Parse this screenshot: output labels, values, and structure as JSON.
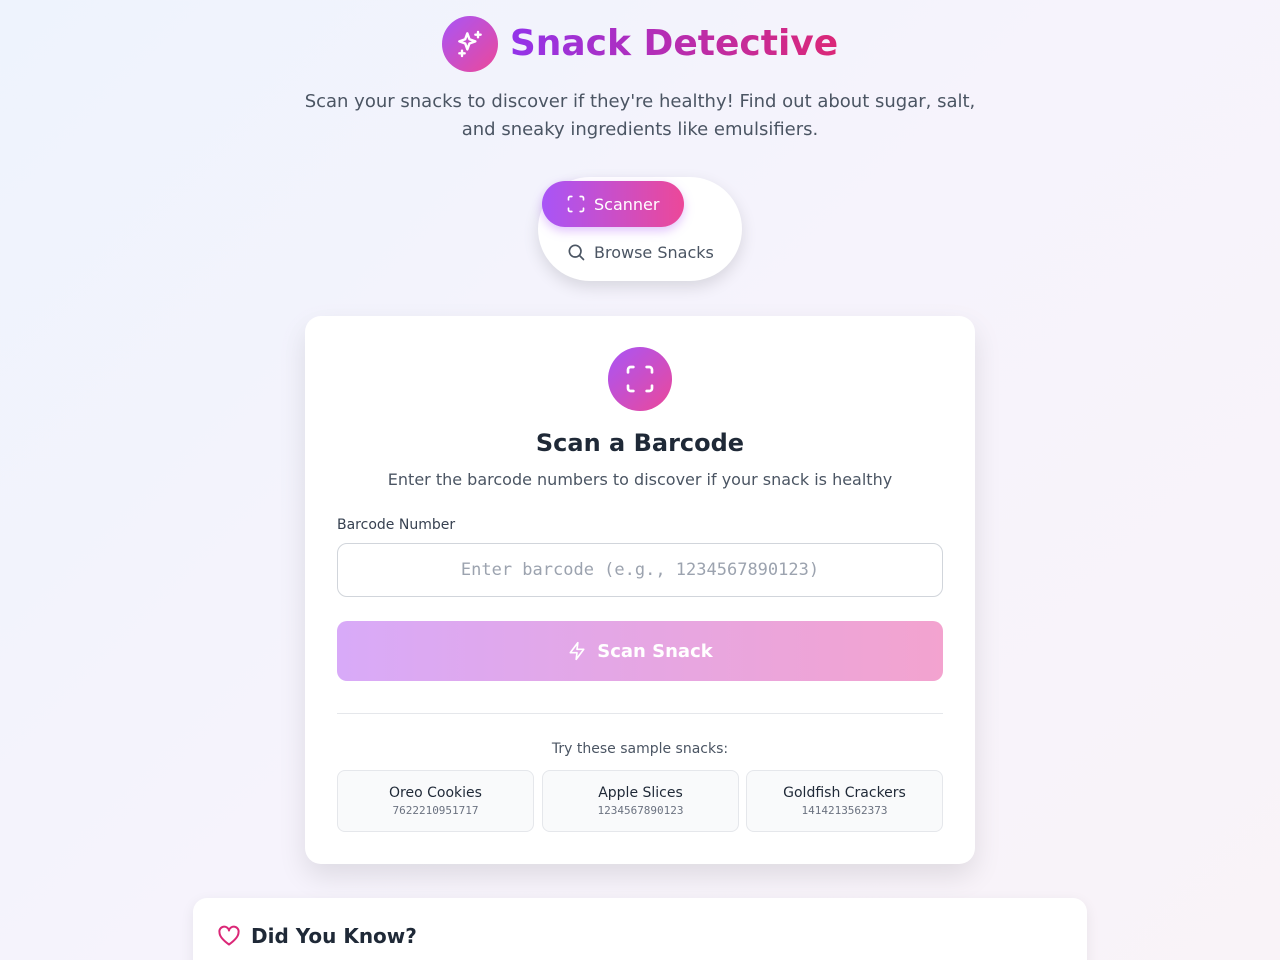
{
  "app": {
    "title": "Snack Detective",
    "subtitle": "Scan your snacks to discover if they're healthy! Find out about sugar, salt, and sneaky ingredients like emulsifiers.",
    "logo_icon": "sparkles-icon"
  },
  "nav": {
    "items": [
      {
        "label": "Scanner",
        "icon": "scan-icon",
        "active": true
      },
      {
        "label": "Browse Snacks",
        "icon": "search-icon",
        "active": false
      }
    ]
  },
  "scanner": {
    "icon": "scan-icon",
    "title": "Scan a Barcode",
    "description": "Enter the barcode numbers to discover if your snack is healthy",
    "field_label": "Barcode Number",
    "input_value": "",
    "input_placeholder": "Enter barcode (e.g., 1234567890123)",
    "scan_button_label": "Scan Snack",
    "scan_button_icon": "lightning-icon",
    "samples_label": "Try these sample snacks:",
    "samples": [
      {
        "name": "Oreo Cookies",
        "barcode": "7622210951717"
      },
      {
        "name": "Apple Slices",
        "barcode": "1234567890123"
      },
      {
        "name": "Goldfish Crackers",
        "barcode": "1414213562373"
      }
    ]
  },
  "tips": {
    "icon": "heart-icon",
    "title": "Did You Know?"
  },
  "colors": {
    "accent_start": "#a855f7",
    "accent_end": "#ec4899",
    "heart": "#db2777"
  }
}
